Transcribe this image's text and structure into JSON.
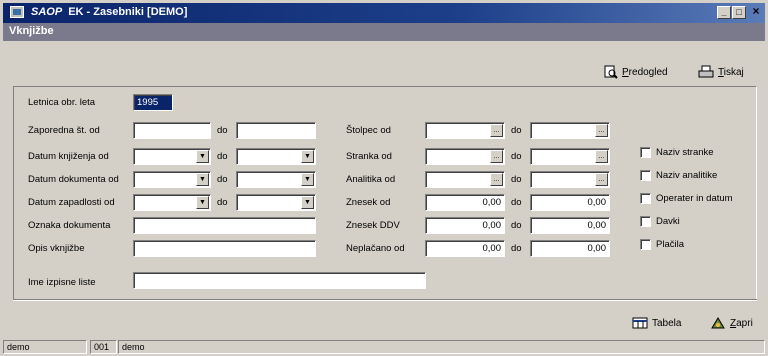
{
  "window": {
    "brand": "SAOP",
    "title": "EK - Zasebniki [DEMO]",
    "subtitle": "Vknjižbe",
    "minimize": "_",
    "restore": "□",
    "close": "×"
  },
  "toolbar": {
    "preview_key": "P",
    "preview_rest": "redogled",
    "print_key": "T",
    "print_rest": "iskaj"
  },
  "form": {
    "letnica_label": "Letnica obr. leta",
    "letnica_value": "1995",
    "zap_label": "Zaporedna št. od",
    "datum_knj_label": "Datum knjiženja od",
    "datum_dok_label": "Datum dokumenta od",
    "datum_zap_label": "Datum zapadlosti od",
    "oznaka_label": "Oznaka dokumenta",
    "opis_label": "Opis vknjižbe",
    "ime_label": "Ime izpisne liste",
    "do": "do",
    "stolpec_label": "Štolpec od",
    "stranka_label": "Stranka od",
    "analitika_label": "Analitika od",
    "znesek_label": "Znesek od",
    "znesek_ddv_label": "Znesek DDV",
    "neplacano_label": "Neplačano od",
    "zero": "0,00",
    "ellipsis": "...",
    "dropdown_glyph": "▼"
  },
  "checkboxes": [
    "Naziv stranke",
    "Naziv analitike",
    "Operater in datum",
    "Davki",
    "Plačila"
  ],
  "bottom": {
    "tabela": "Tabela",
    "zapri_key": "Z",
    "zapri_rest": "apri"
  },
  "status": {
    "user": "demo",
    "code": "001",
    "company": "demo"
  }
}
